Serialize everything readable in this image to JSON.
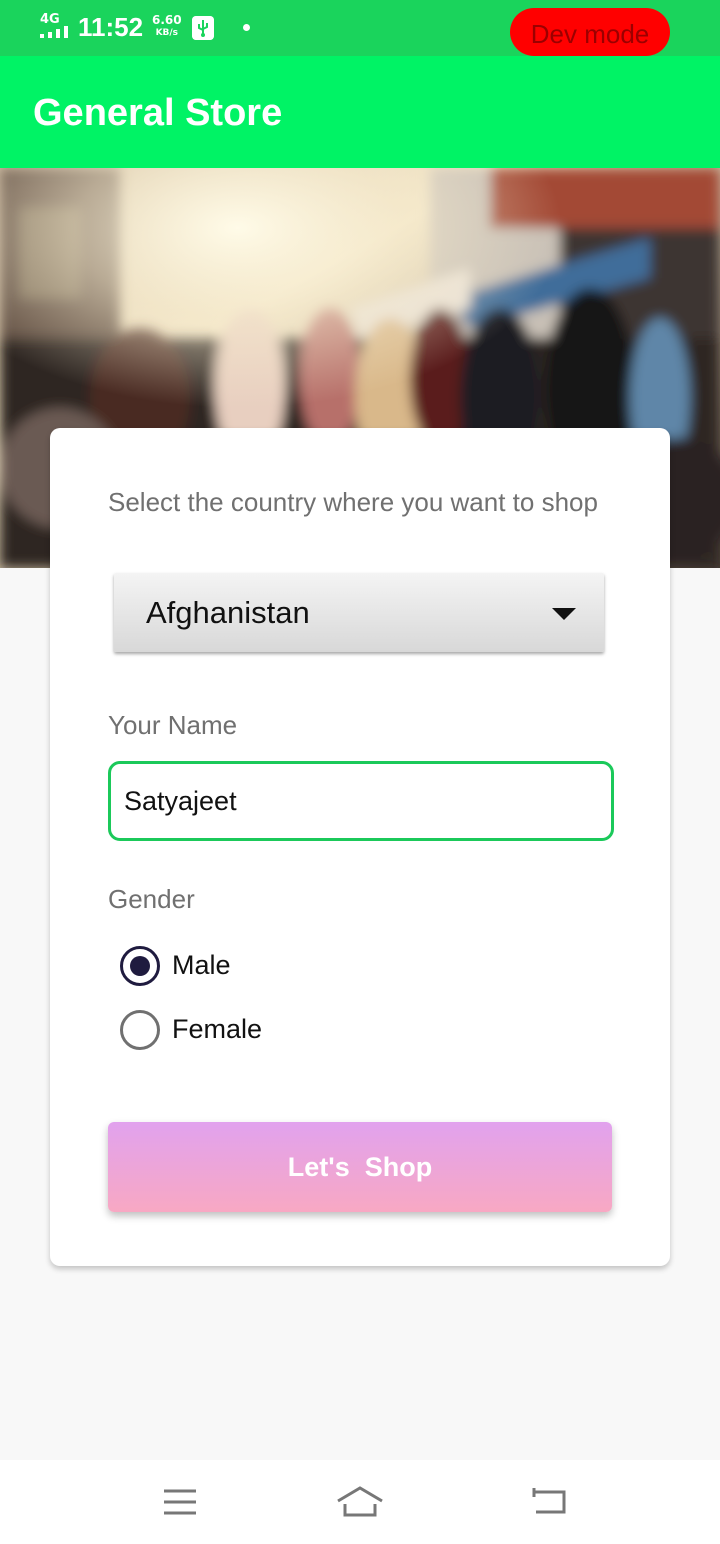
{
  "status_bar": {
    "network": "4G",
    "time": "11:52",
    "speed_value": "6.60",
    "speed_unit": "KB/s",
    "dev_mode_label": "Dev mode",
    "colors": {
      "background": "#1ad45c",
      "dev_mode": "#ff0000"
    }
  },
  "app_bar": {
    "title": "General Store",
    "color": "#00f365"
  },
  "hero": {
    "image_icon": "street-crowd-image"
  },
  "form": {
    "country_label": "Select the country where you want to shop",
    "country_selected": "Afghanistan",
    "name_label": "Your Name",
    "name_value": "Satyajeet",
    "gender_label": "Gender",
    "gender_options": [
      {
        "label": "Male",
        "checked": true
      },
      {
        "label": "Female",
        "checked": false
      }
    ],
    "submit_label": "Let's  Shop",
    "accent_color": "#1bc95a"
  },
  "nav_bar": {
    "icons": [
      "menu-icon",
      "home-icon",
      "back-icon"
    ]
  }
}
